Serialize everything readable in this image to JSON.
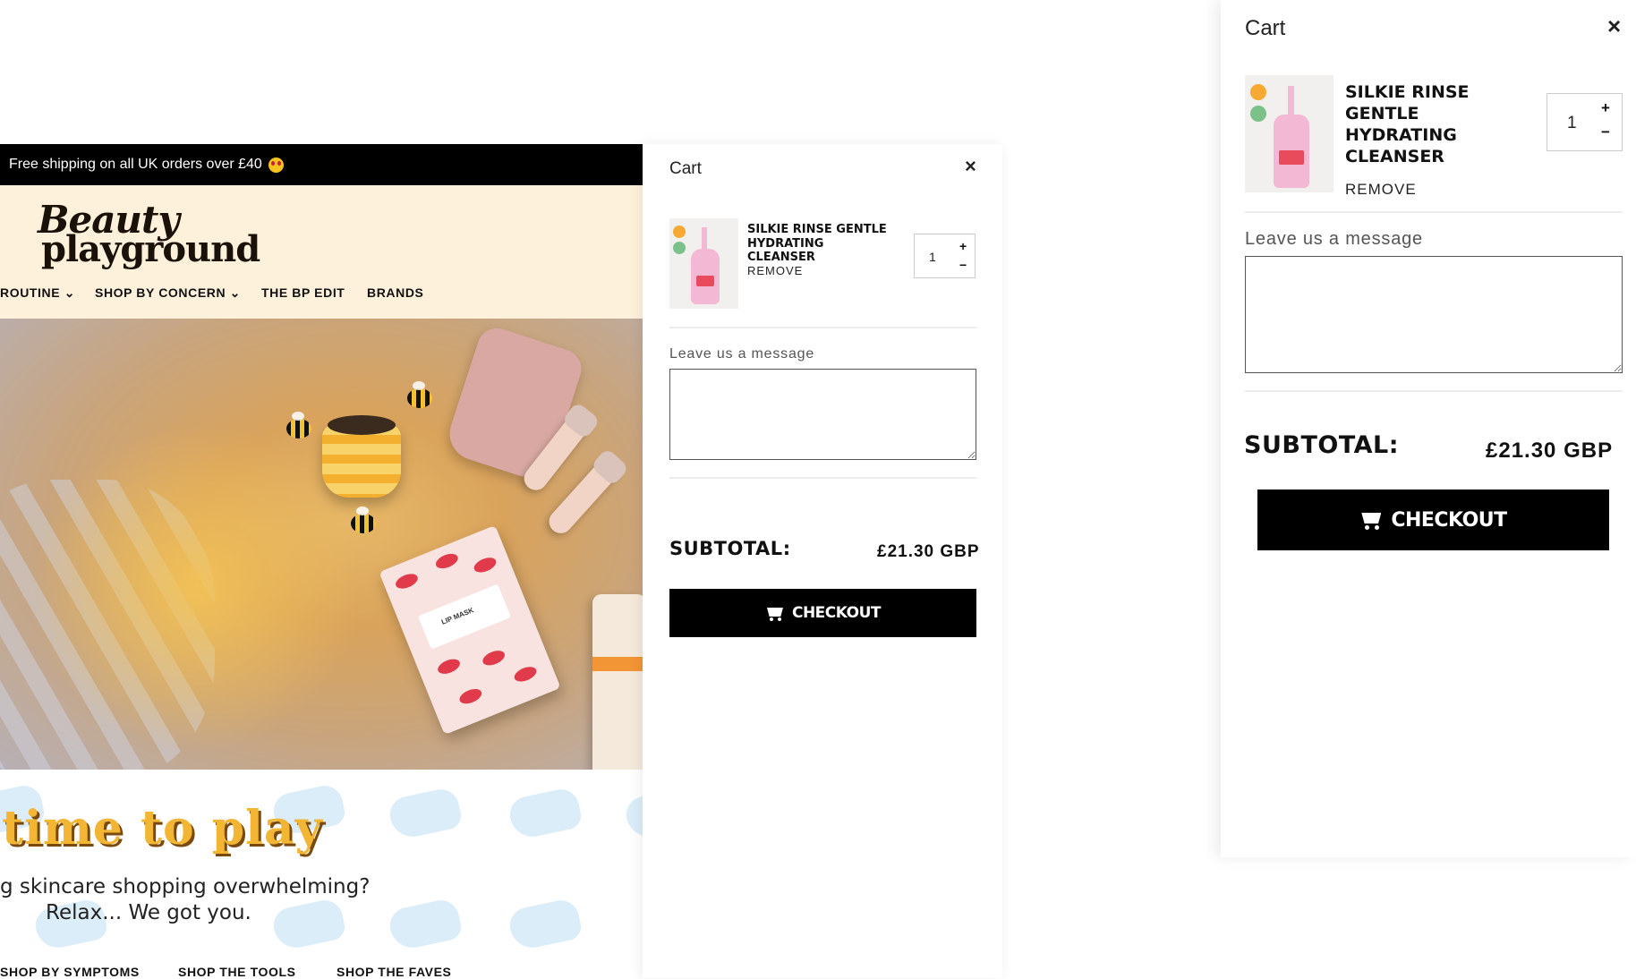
{
  "site": {
    "announcement": "Free shipping on all UK orders over £40",
    "logo": {
      "line1": "Beauty",
      "line2": "playground"
    },
    "nav": [
      "ROUTINE",
      "SHOP BY CONCERN",
      "THE BP EDIT",
      "BRANDS"
    ],
    "hero_mask_label": "LIP MASK",
    "tagline": "time to play",
    "sub1": "g skincare shopping overwhelming?",
    "sub2": "Relax... We got you.",
    "bottom_nav": [
      "SHOP BY SYMPTOMS",
      "SHOP THE TOOLS",
      "SHOP THE FAVES"
    ]
  },
  "cart": {
    "title": "Cart",
    "close_glyph": "×",
    "item": {
      "name": "SILKIE RINSE GENTLE HYDRATING CLEANSER",
      "name_lines": [
        "SILKIE RINSE",
        "GENTLE",
        "HYDRATING",
        "CLEANSER"
      ],
      "remove_label": "REMOVE",
      "quantity": "1",
      "plus": "+",
      "minus": "−"
    },
    "message_label": "Leave us a message",
    "subtotal_label": "SUBTOTAL:",
    "subtotal_value": "£21.30 GBP",
    "checkout_label": "CHECKOUT"
  },
  "colors": {
    "announcement_bg": "#000000",
    "header_bg": "#fdf1dc",
    "checkout_bg": "#000000",
    "tagline": "#f2b534"
  }
}
